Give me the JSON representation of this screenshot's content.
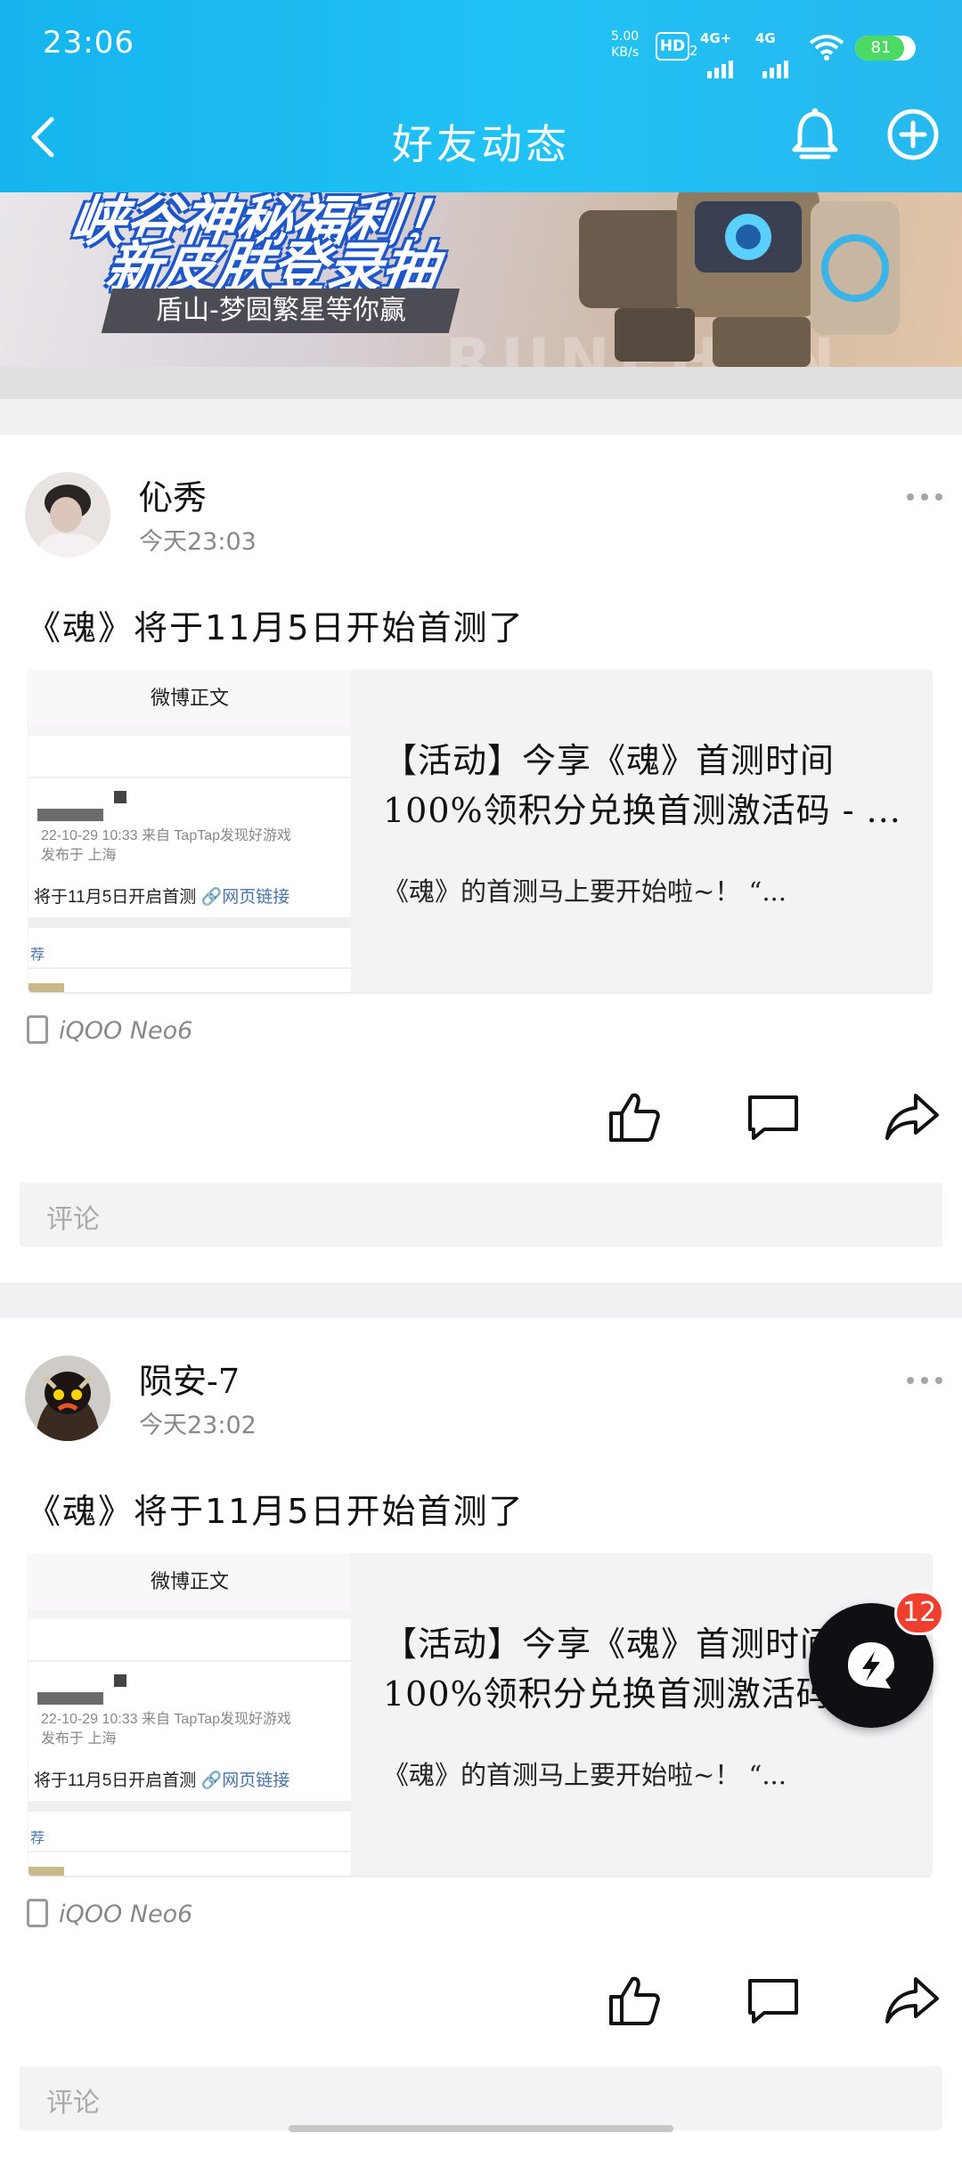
{
  "status_bar": {
    "time": "23:06",
    "net_speed_value": "5.00",
    "net_speed_unit": "KB/s",
    "hd": "HD",
    "hd_sub": "2",
    "sig1": "4G+",
    "sig2": "4G",
    "battery": "81",
    "battery_level": 0.81
  },
  "header": {
    "title": "好友动态"
  },
  "banner": {
    "line1": "峡谷神秘福利！",
    "line2": "新皮肤登录抽",
    "pill": "盾山-梦圆繁星等你赢",
    "bg_text": "RUNEHAN"
  },
  "posts": [
    {
      "username": "伈秀",
      "time": "今天23:03",
      "text": "《魂》将于11月5日开始首测了",
      "thumb": {
        "header": "微博正文",
        "meta1": "22-10-29 10:33  来自 TapTap发现好游戏",
        "meta2": "发布于 上海",
        "body": "将于11月5日开启首测",
        "link": "网页链接",
        "more": "荐"
      },
      "card_title_1": "【活动】今享《魂》首测时间",
      "card_title_2": "100%领积分兑换首测激活码 - ...",
      "card_desc": "《魂》的首测马上要开始啦~！  “...",
      "device": "iQOO Neo6",
      "comment_placeholder": "评论"
    },
    {
      "username": "陨安-7",
      "time": "今天23:02",
      "text": "《魂》将于11月5日开始首测了",
      "thumb": {
        "header": "微博正文",
        "meta1": "22-10-29 10:33  来自 TapTap发现好游戏",
        "meta2": "发布于 上海",
        "body": "将于11月5日开启首测",
        "link": "网页链接",
        "more": "荐"
      },
      "card_title_1": "【活动】今享《魂》首测时间",
      "card_title_2": "100%领积分兑换首测激活码 - ...",
      "card_desc": "《魂》的首测马上要开始啦~！  “...",
      "device": "iQOO Neo6",
      "comment_placeholder": "评论"
    }
  ],
  "float_button": {
    "badge": "12"
  },
  "icons": [
    "back-icon",
    "bell-icon",
    "plus-circle-icon",
    "more-icon",
    "device-icon",
    "like-icon",
    "comment-icon",
    "share-icon",
    "lightning-chat-icon"
  ],
  "colors": {
    "header": "#1fbdf2",
    "badge": "#f03e2e",
    "battery": "#4cd964"
  }
}
